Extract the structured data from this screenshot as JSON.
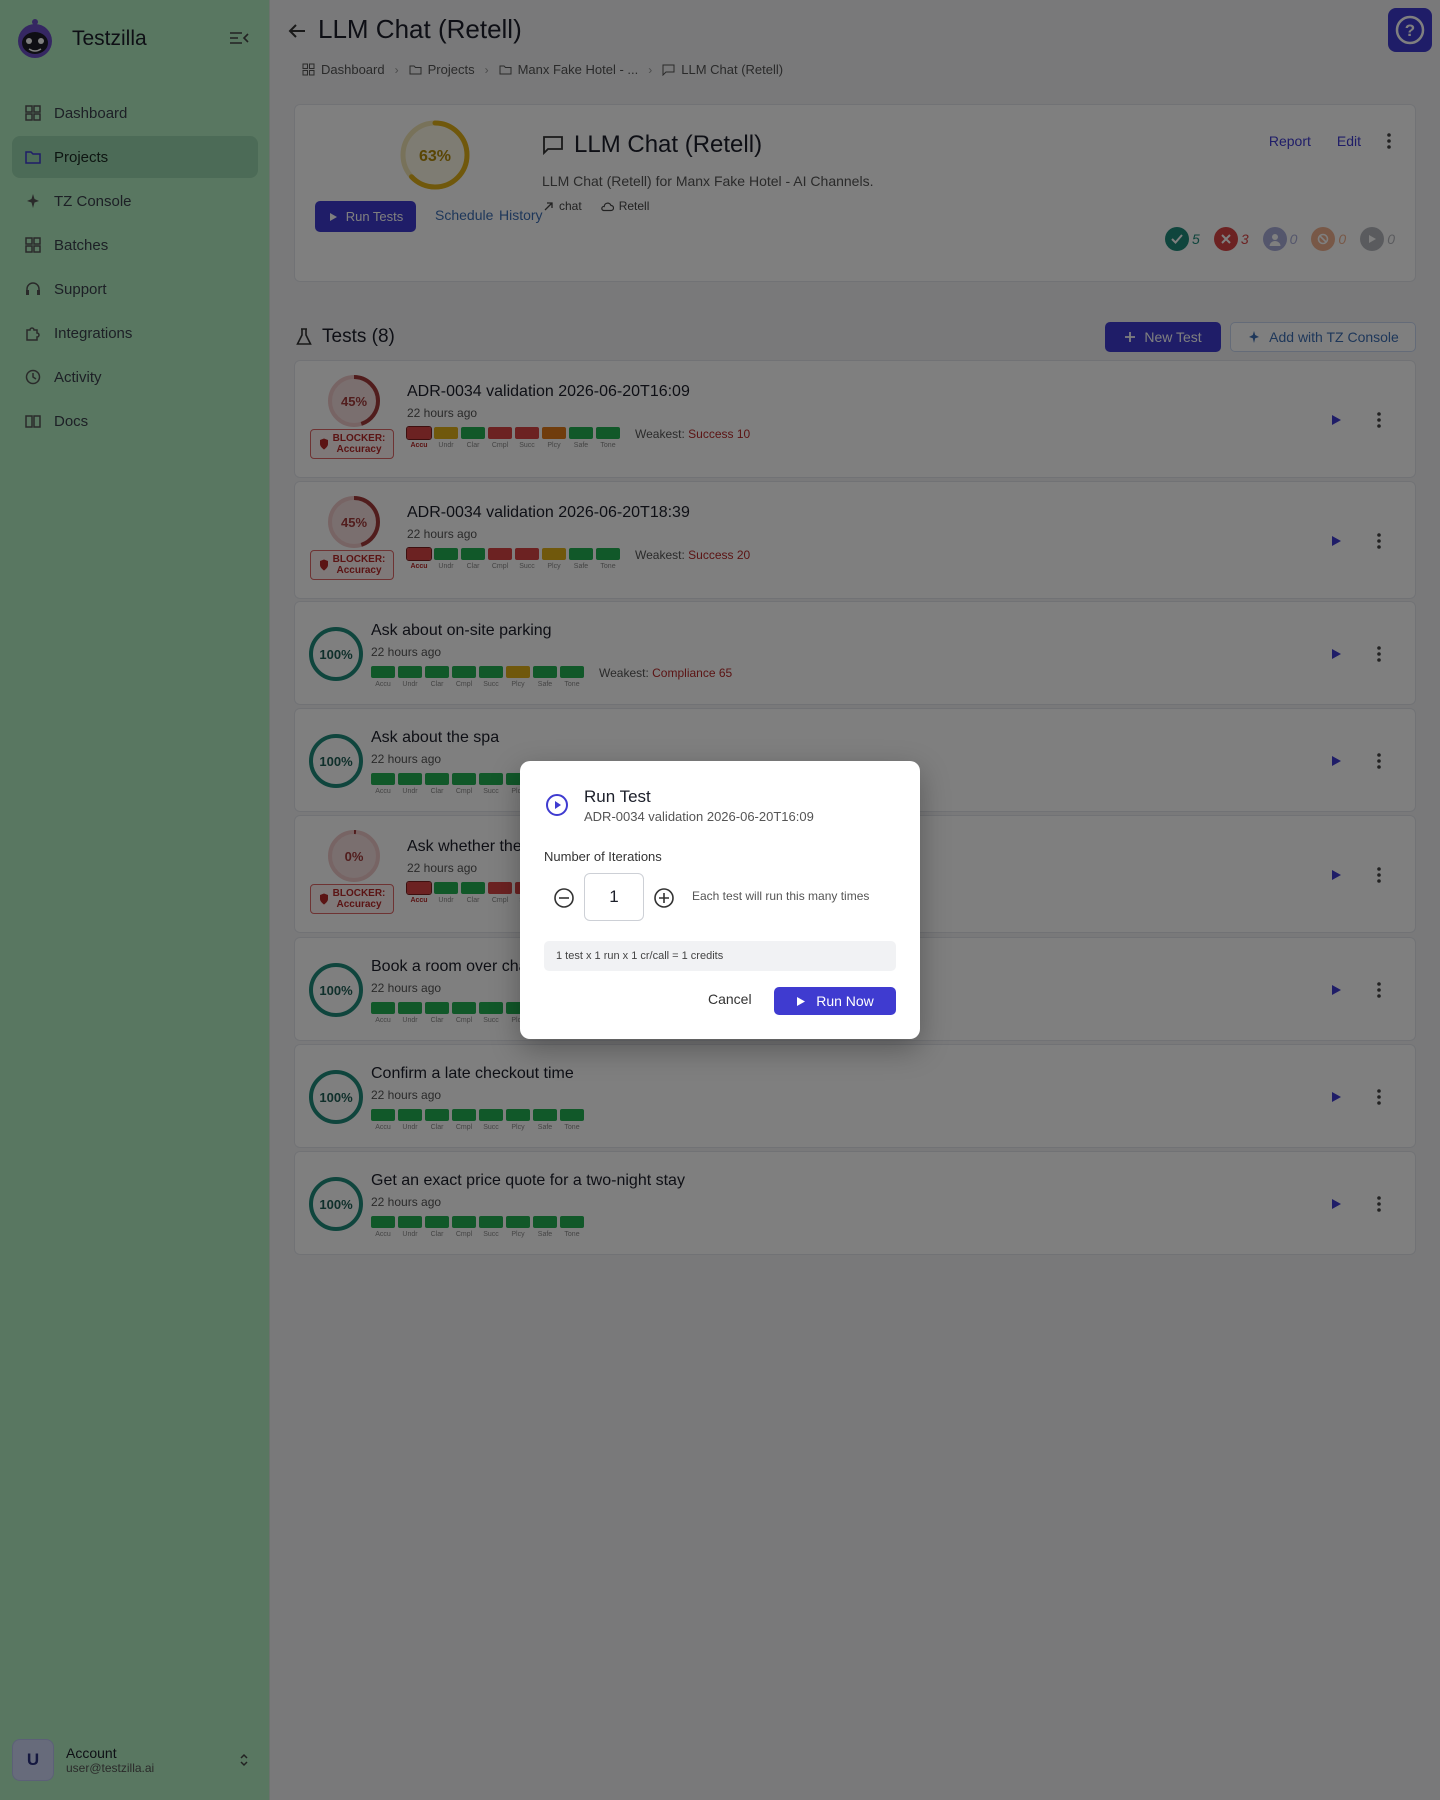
{
  "sidebar": {
    "brand": "Testzilla",
    "items": [
      {
        "label": "Dashboard"
      },
      {
        "label": "Projects"
      },
      {
        "label": "TZ Console"
      },
      {
        "label": "Batches"
      },
      {
        "label": "Support"
      },
      {
        "label": "Integrations"
      },
      {
        "label": "Activity"
      },
      {
        "label": "Docs"
      }
    ],
    "active": "Projects",
    "account": {
      "initial": "U",
      "label": "Account",
      "email": "user@testzilla.ai"
    }
  },
  "header": {
    "title": "LLM Chat (Retell)",
    "help": "?",
    "breadcrumbs": [
      "Dashboard",
      "Projects",
      "Manx Fake Hotel - ...",
      "LLM Chat (Retell)"
    ]
  },
  "project": {
    "score": "63%",
    "score_value": 0.63,
    "score_color": "#e0b019",
    "run_tests": "Run Tests",
    "schedule": "Schedule",
    "history": "History",
    "title": "LLM Chat (Retell)",
    "description": "LLM Chat (Retell) for Manx Fake Hotel - AI Channels.",
    "tags": [
      "chat",
      "Retell"
    ],
    "report": "Report",
    "edit": "Edit",
    "stats": {
      "passed": "5",
      "failed": "3",
      "human": "0",
      "skipped": "0",
      "pending": "0"
    }
  },
  "tests_header": {
    "title": "Tests (8)",
    "new_test": "New Test",
    "add_tz": "Add with TZ Console"
  },
  "criteria_labels": [
    "Accu",
    "Undr",
    "Clar",
    "Cmpl",
    "Succ",
    "Plcy",
    "Safe",
    "Tone"
  ],
  "colors": {
    "red": "#d94545",
    "orange": "#e07a1a",
    "yellow": "#e0b019",
    "green": "#22b052",
    "accent": "#3f3bd0",
    "teal": "#1f8a7a"
  },
  "tests": [
    {
      "name": "ADR-0034 validation 2026-06-20T16:09",
      "ago": "22 hours ago",
      "score": "45%",
      "score_value": 0.45,
      "blocker_l1": "BLOCKER:",
      "blocker_l2": "Accuracy",
      "weak_label": "Weakest:",
      "weak_value": "Success 10",
      "bars": [
        "red",
        "yellow",
        "green",
        "red",
        "red",
        "orange",
        "green",
        "green"
      ]
    },
    {
      "name": "ADR-0034 validation 2026-06-20T18:39",
      "ago": "22 hours ago",
      "score": "45%",
      "score_value": 0.45,
      "blocker_l1": "BLOCKER:",
      "blocker_l2": "Accuracy",
      "weak_label": "Weakest:",
      "weak_value": "Success 20",
      "bars": [
        "red",
        "green",
        "green",
        "red",
        "red",
        "yellow",
        "green",
        "green"
      ]
    },
    {
      "name": "Ask about on-site parking",
      "ago": "22 hours ago",
      "score": "100%",
      "score_value": 1,
      "weak_label": "Weakest:",
      "weak_value": "Compliance 65",
      "bars": [
        "green",
        "green",
        "green",
        "green",
        "green",
        "yellow",
        "green",
        "green"
      ]
    },
    {
      "name": "Ask about the spa",
      "ago": "22 hours ago",
      "score": "100%",
      "score_value": 1,
      "bars": [
        "green",
        "green",
        "green",
        "green",
        "green",
        "green",
        "green",
        "green"
      ]
    },
    {
      "name": "Ask whether the",
      "ago": "22 hours ago",
      "score": "0%",
      "score_value": 0,
      "blocker_l1": "BLOCKER:",
      "blocker_l2": "Accuracy",
      "bars": [
        "red",
        "green",
        "green",
        "red",
        "red",
        "green",
        "green",
        "green"
      ]
    },
    {
      "name": "Book a room over cha",
      "ago": "22 hours ago",
      "score": "100%",
      "score_value": 1,
      "bars": [
        "green",
        "green",
        "green",
        "green",
        "green",
        "green",
        "green",
        "green"
      ]
    },
    {
      "name": "Confirm a late checkout time",
      "ago": "22 hours ago",
      "score": "100%",
      "score_value": 1,
      "bars": [
        "green",
        "green",
        "green",
        "green",
        "green",
        "green",
        "green",
        "green"
      ]
    },
    {
      "name": "Get an exact price quote for a two-night stay",
      "ago": "22 hours ago",
      "score": "100%",
      "score_value": 1,
      "bars": [
        "green",
        "green",
        "green",
        "green",
        "green",
        "green",
        "green",
        "green"
      ]
    }
  ],
  "modal": {
    "title": "Run Test",
    "subtitle": "ADR-0034 validation 2026-06-20T16:09",
    "iterations_label": "Number of Iterations",
    "iterations_value": "1",
    "hint": "Each test will run this many times",
    "credits": "1 test x 1 run x 1 cr/call = 1 credits",
    "cancel": "Cancel",
    "run_now": "Run Now"
  }
}
